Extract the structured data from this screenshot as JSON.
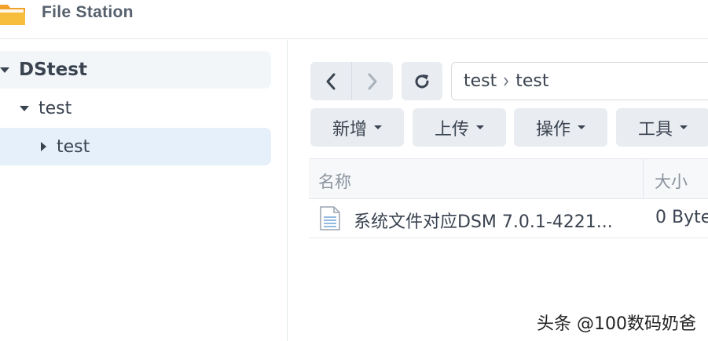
{
  "app": {
    "title": "File Station",
    "icon": "folder-icon"
  },
  "sidebar": {
    "tree": [
      {
        "label": "DStest",
        "expanded": true
      },
      {
        "label": "test",
        "expanded": true
      },
      {
        "label": "test",
        "expanded": false,
        "selected": true
      }
    ]
  },
  "toolbar": {
    "back_icon": "chevron-left-icon",
    "forward_icon": "chevron-right-icon",
    "refresh_icon": "refresh-icon",
    "path": [
      "test",
      "test"
    ],
    "buttons": {
      "new": "新增",
      "upload": "上传",
      "action": "操作",
      "tools": "工具"
    }
  },
  "table": {
    "columns": {
      "name": "名称",
      "size": "大小"
    },
    "rows": [
      {
        "name": "系统文件对应DSM 7.0.1-4221...",
        "size": "0 Byte"
      }
    ]
  },
  "watermark": "头条 @100数码奶爸",
  "colors": {
    "accent_selected": "#e5f0fb",
    "button_bg": "#e9edf2",
    "text": "#3a4350",
    "muted_text": "#8a939e"
  }
}
